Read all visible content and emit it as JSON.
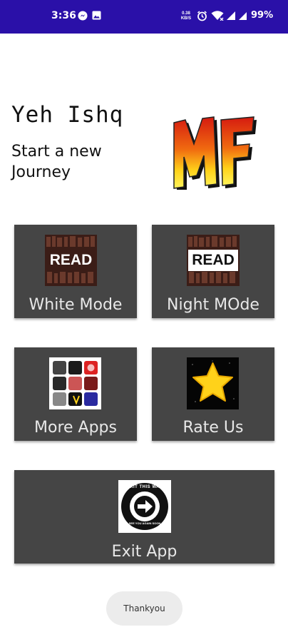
{
  "status_bar": {
    "time": "3:36",
    "net_speed_value": "0.38",
    "net_speed_unit": "KB/S",
    "battery": "99%",
    "icons": [
      "messenger-icon",
      "gallery-icon",
      "network-speed",
      "alarm-icon",
      "wifi-icon",
      "signal-icon",
      "battery-percent"
    ]
  },
  "header": {
    "title": "Yeh Ishq",
    "subtitle": "Start a new Journey",
    "logo_text": "MF"
  },
  "tiles": {
    "white_mode": {
      "label": "White Mode",
      "thumb_text": "READ"
    },
    "night_mode": {
      "label": "Night MOde",
      "thumb_text": "READ"
    },
    "more_apps": {
      "label": "More Apps"
    },
    "rate_us": {
      "label": "Rate Us"
    },
    "exit_app": {
      "label": "Exit App",
      "thumb_text_top": "EXIT THIS WAY",
      "thumb_text_bottom": "SEE YOU AGAIN SOON"
    }
  },
  "toast": {
    "text": "Thankyou"
  },
  "colors": {
    "status_bar": "#2a10a8",
    "tile_bg": "#454545",
    "tile_text": "#e8e8e8",
    "star": "#ffd21a"
  }
}
